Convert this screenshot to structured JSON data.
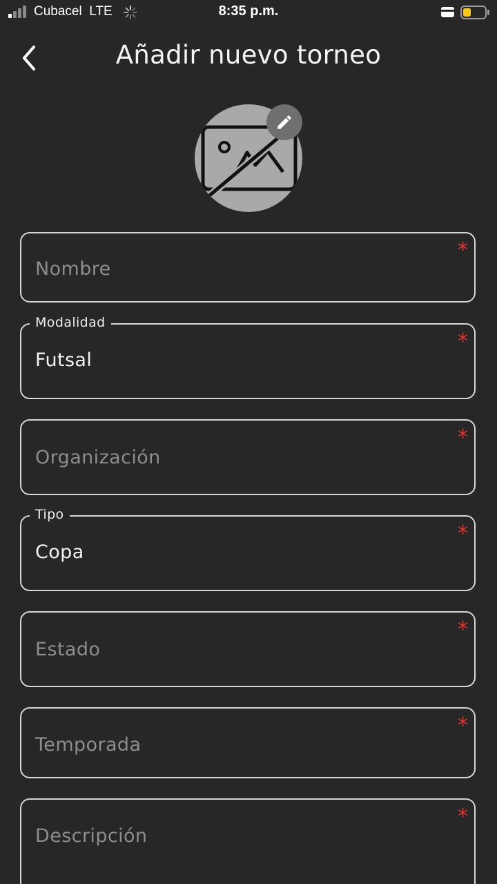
{
  "status_bar": {
    "carrier": "Cubacel",
    "network": "LTE",
    "time": "8:35 p.m."
  },
  "header": {
    "title": "Añadir nuevo torneo",
    "back_icon": "chevron-left-icon"
  },
  "avatar": {
    "placeholder_icon": "image-off-icon",
    "edit_icon": "pencil-icon"
  },
  "form": {
    "required_marker": "*",
    "nombre": {
      "placeholder": "Nombre"
    },
    "modalidad": {
      "label": "Modalidad",
      "value": "Futsal"
    },
    "organizacion": {
      "placeholder": "Organización"
    },
    "tipo": {
      "label": "Tipo",
      "value": "Copa"
    },
    "estado": {
      "placeholder": "Estado"
    },
    "temporada": {
      "placeholder": "Temporada"
    },
    "descripcion": {
      "placeholder": "Descripción"
    }
  },
  "colors": {
    "background": "#272727",
    "border": "#d6d6d6",
    "required": "#e0352d",
    "battery_fill": "#f7c815"
  }
}
